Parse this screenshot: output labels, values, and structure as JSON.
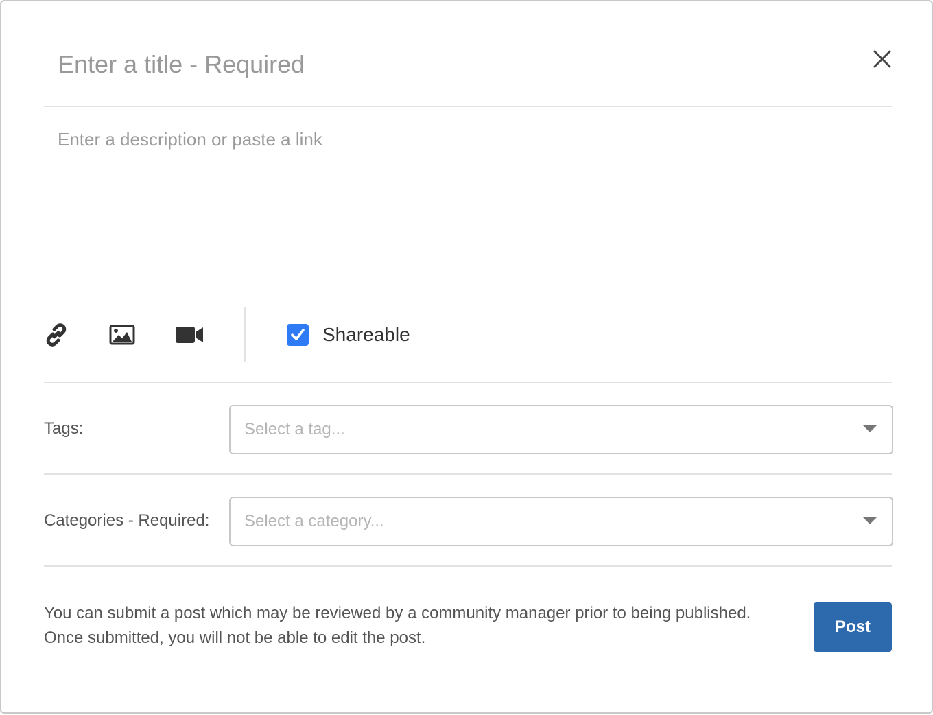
{
  "title_field": {
    "placeholder": "Enter a title - Required",
    "value": ""
  },
  "description_field": {
    "placeholder": "Enter a description or paste a link",
    "value": ""
  },
  "toolbar": {
    "icons": [
      "link-icon",
      "image-icon",
      "video-icon"
    ],
    "shareable": {
      "label": "Shareable",
      "checked": true
    }
  },
  "tags": {
    "label": "Tags:",
    "placeholder": "Select a tag..."
  },
  "categories": {
    "label": "Categories - Required:",
    "placeholder": "Select a category..."
  },
  "footer": {
    "notice_line1": "You can submit a post which may be reviewed by a community manager prior to being published.",
    "notice_line2": "Once submitted, you will not be able to edit the post.",
    "post_label": "Post"
  },
  "colors": {
    "accent": "#2d6aad",
    "checkbox": "#2f7bf5",
    "divider": "#e3e3e3",
    "placeholder": "#999999"
  }
}
